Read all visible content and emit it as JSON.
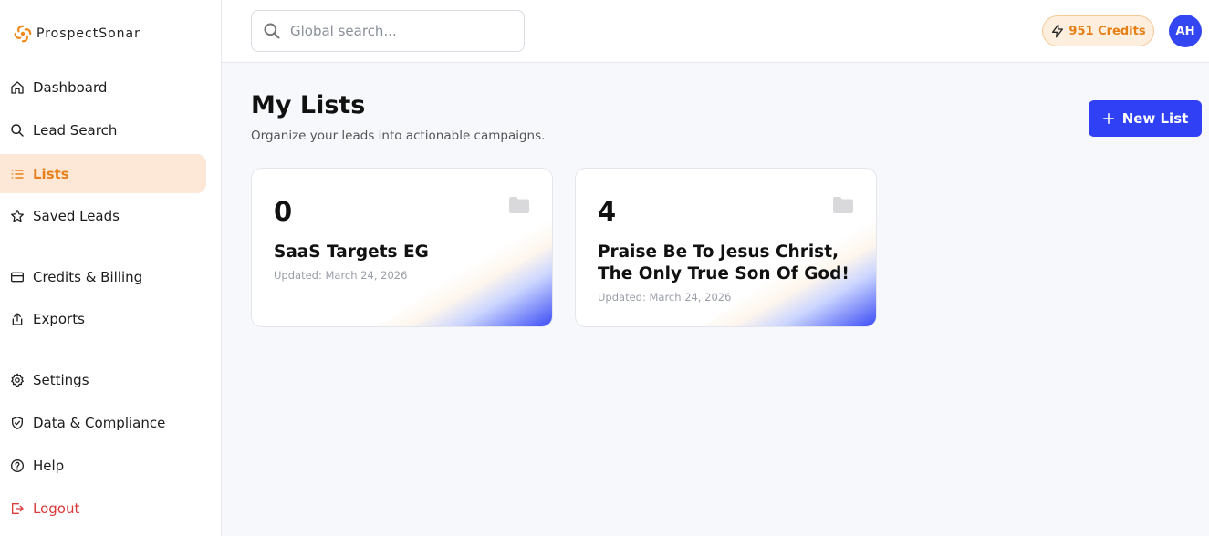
{
  "app": {
    "logo_text": "ProspectSonar"
  },
  "sidebar": {
    "items": [
      {
        "label": "Dashboard",
        "icon": "home-icon"
      },
      {
        "label": "Lead Search",
        "icon": "search-icon"
      },
      {
        "label": "Lists",
        "icon": "list-icon",
        "active": true
      },
      {
        "label": "Saved Leads",
        "icon": "star-icon"
      },
      {
        "label": "Credits & Billing",
        "icon": "credit-card-icon"
      },
      {
        "label": "Exports",
        "icon": "export-icon"
      },
      {
        "label": "Settings",
        "icon": "gear-icon"
      },
      {
        "label": "Data & Compliance",
        "icon": "shield-icon"
      },
      {
        "label": "Help",
        "icon": "help-icon"
      },
      {
        "label": "Logout",
        "icon": "logout-icon"
      }
    ]
  },
  "header": {
    "search_placeholder": "Global search...",
    "credits_label": "951 Credits",
    "avatar_initials": "AH"
  },
  "main": {
    "title": "My Lists",
    "subtitle": "Organize your leads into actionable campaigns.",
    "new_list_label": "New List",
    "lists": [
      {
        "count": "0",
        "name": "SaaS Targets EG",
        "updated": "Updated: March 24, 2026"
      },
      {
        "count": "4",
        "name": "Praise Be To Jesus Christ, The Only True Son Of God!",
        "updated": "Updated: March 24, 2026"
      }
    ]
  },
  "colors": {
    "accent": "#2f40f5",
    "active_orange": "#e8801a",
    "active_bg": "#fde8d7",
    "logout_red": "#d93a3a"
  }
}
